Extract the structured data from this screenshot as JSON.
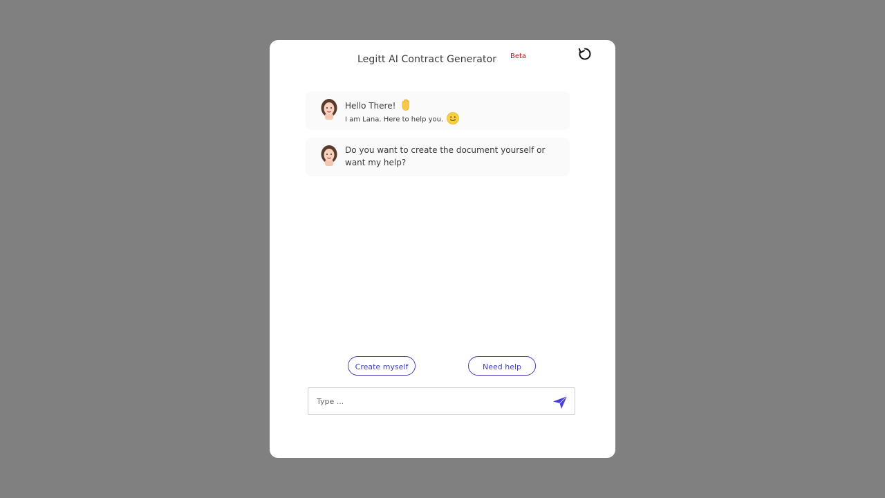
{
  "header": {
    "title": "Legitt AI Contract Generator",
    "badge": "Beta",
    "refresh_icon": "refresh-icon"
  },
  "messages": [
    {
      "avatar": "female-avatar-icon",
      "line1": "Hello There!",
      "line1_emoji": "👋",
      "line2": "I am Lana. Here to help you.",
      "line2_emoji": "🙂"
    },
    {
      "avatar": "female-avatar-icon",
      "text": "Do you want to create the document yourself or want my help?"
    }
  ],
  "choices": {
    "create_label": "Create myself",
    "help_label": "Need help"
  },
  "composer": {
    "placeholder": "Type ...",
    "value": "",
    "send_icon": "send-icon"
  },
  "colors": {
    "accent": "#3f3fb8",
    "send": "#4a3fd6",
    "badge": "#d0021b",
    "backdrop": "#808080"
  }
}
